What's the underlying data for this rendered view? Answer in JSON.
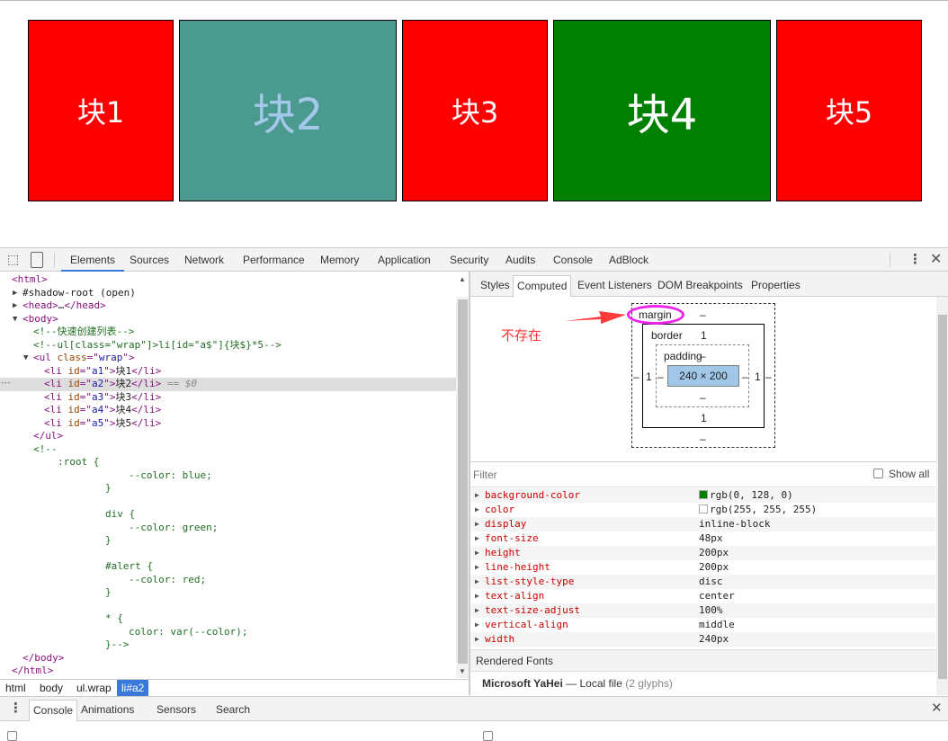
{
  "page": {
    "blocks": [
      {
        "label": "块1",
        "bg": "#ff0000",
        "fg": "#ffffff"
      },
      {
        "label": "块2",
        "bg": "#4a9a8f",
        "fg": "#a3c8ea"
      },
      {
        "label": "块3",
        "bg": "#ff0000",
        "fg": "#ffffff"
      },
      {
        "label": "块4",
        "bg": "#008000",
        "fg": "#ffffff"
      },
      {
        "label": "块5",
        "bg": "#ff0000",
        "fg": "#ffffff"
      }
    ]
  },
  "devtools": {
    "main_tabs": [
      "Elements",
      "Sources",
      "Network",
      "Performance",
      "Memory",
      "Application",
      "Security",
      "Audits",
      "Console",
      "AdBlock"
    ],
    "active_tab": "Elements",
    "dom_lines": [
      [
        {
          "k": "tag",
          "t": "<html>"
        }
      ],
      [
        {
          "k": "plain",
          "t": "#shadow-root (open)"
        }
      ],
      [
        {
          "k": "tag",
          "t": "<head>"
        },
        {
          "k": "plain",
          "t": "…"
        },
        {
          "k": "tag",
          "t": "</head>"
        }
      ],
      [
        {
          "k": "tag",
          "t": "<body>"
        }
      ],
      [
        {
          "k": "cm",
          "t": "<!--快速创建列表-->"
        }
      ],
      [
        {
          "k": "cm",
          "t": "<!--ul[class=\"wrap\"]>li[id=\"a$\"]{块$}*5-->"
        }
      ],
      [
        {
          "k": "tag",
          "t": "<ul "
        },
        {
          "k": "attr",
          "t": "class"
        },
        {
          "k": "tag",
          "t": "=\""
        },
        {
          "k": "val",
          "t": "wrap"
        },
        {
          "k": "tag",
          "t": "\">"
        }
      ],
      [
        {
          "k": "tag",
          "t": "<li "
        },
        {
          "k": "attr",
          "t": "id"
        },
        {
          "k": "tag",
          "t": "=\""
        },
        {
          "k": "val",
          "t": "a1"
        },
        {
          "k": "tag",
          "t": "\">"
        },
        {
          "k": "plain",
          "t": "块1"
        },
        {
          "k": "tag",
          "t": "</li>"
        }
      ],
      [
        {
          "k": "tag",
          "t": "<li "
        },
        {
          "k": "attr",
          "t": "id"
        },
        {
          "k": "tag",
          "t": "=\""
        },
        {
          "k": "val",
          "t": "a2"
        },
        {
          "k": "tag",
          "t": "\">"
        },
        {
          "k": "plain",
          "t": "块2"
        },
        {
          "k": "tag",
          "t": "</li>"
        },
        {
          "k": "dim",
          "t": " == $0"
        }
      ],
      [
        {
          "k": "tag",
          "t": "<li "
        },
        {
          "k": "attr",
          "t": "id"
        },
        {
          "k": "tag",
          "t": "=\""
        },
        {
          "k": "val",
          "t": "a3"
        },
        {
          "k": "tag",
          "t": "\">"
        },
        {
          "k": "plain",
          "t": "块3"
        },
        {
          "k": "tag",
          "t": "</li>"
        }
      ],
      [
        {
          "k": "tag",
          "t": "<li "
        },
        {
          "k": "attr",
          "t": "id"
        },
        {
          "k": "tag",
          "t": "=\""
        },
        {
          "k": "val",
          "t": "a4"
        },
        {
          "k": "tag",
          "t": "\">"
        },
        {
          "k": "plain",
          "t": "块4"
        },
        {
          "k": "tag",
          "t": "</li>"
        }
      ],
      [
        {
          "k": "tag",
          "t": "<li "
        },
        {
          "k": "attr",
          "t": "id"
        },
        {
          "k": "tag",
          "t": "=\""
        },
        {
          "k": "val",
          "t": "a5"
        },
        {
          "k": "tag",
          "t": "\">"
        },
        {
          "k": "plain",
          "t": "块5"
        },
        {
          "k": "tag",
          "t": "</li>"
        }
      ],
      [
        {
          "k": "tag",
          "t": "</ul>"
        }
      ],
      [
        {
          "k": "cm",
          "t": "<!--"
        }
      ],
      [
        {
          "k": "cm",
          "t": ":root {"
        }
      ],
      [
        {
          "k": "cm",
          "t": "--color: blue;"
        }
      ],
      [
        {
          "k": "cm",
          "t": "}"
        }
      ],
      [],
      [
        {
          "k": "cm",
          "t": "div {"
        }
      ],
      [
        {
          "k": "cm",
          "t": "--color: green;"
        }
      ],
      [
        {
          "k": "cm",
          "t": "}"
        }
      ],
      [],
      [
        {
          "k": "cm",
          "t": "#alert {"
        }
      ],
      [
        {
          "k": "cm",
          "t": "--color: red;"
        }
      ],
      [
        {
          "k": "cm",
          "t": "}"
        }
      ],
      [],
      [
        {
          "k": "cm",
          "t": "* {"
        }
      ],
      [
        {
          "k": "cm",
          "t": "color: var(--color);"
        }
      ],
      [
        {
          "k": "cm",
          "t": "}-->"
        }
      ],
      [
        {
          "k": "tag",
          "t": "</body>"
        }
      ],
      [
        {
          "k": "tag",
          "t": "</html>"
        }
      ]
    ],
    "breadcrumbs": [
      "html",
      "body",
      "ul.wrap",
      "li#a2"
    ],
    "side_tabs": [
      "Styles",
      "Computed",
      "Event Listeners",
      "DOM Breakpoints",
      "Properties"
    ],
    "active_side_tab": "Computed",
    "box_model": {
      "margin_label": "margin",
      "border_label": "border",
      "padding_label": "padding",
      "margin": {
        "top": "–",
        "right": "–",
        "bottom": "–",
        "left": "–"
      },
      "border": {
        "top": "1",
        "right": "1",
        "bottom": "1",
        "left": "1"
      },
      "padding": {
        "top": "–",
        "right": "–",
        "bottom": "–",
        "left": "–"
      },
      "content": "240 × 200"
    },
    "annotation": {
      "text": "不存在",
      "color": "#ff3333",
      "circle_color": "#ee22ee"
    },
    "filter_placeholder": "Filter",
    "show_all_label": "Show all",
    "computed": [
      {
        "name": "background-color",
        "value": "rgb(0, 128, 0)",
        "swatch": "#008000"
      },
      {
        "name": "color",
        "value": "rgb(255, 255, 255)",
        "swatch": "#ffffff"
      },
      {
        "name": "display",
        "value": "inline-block"
      },
      {
        "name": "font-size",
        "value": "48px"
      },
      {
        "name": "height",
        "value": "200px"
      },
      {
        "name": "line-height",
        "value": "200px"
      },
      {
        "name": "list-style-type",
        "value": "disc"
      },
      {
        "name": "text-align",
        "value": "center"
      },
      {
        "name": "text-size-adjust",
        "value": "100%"
      },
      {
        "name": "vertical-align",
        "value": "middle"
      },
      {
        "name": "width",
        "value": "240px"
      }
    ],
    "rendered_fonts_title": "Rendered Fonts",
    "font_name": "Microsoft YaHei",
    "font_dash": "—",
    "font_source": "Local file",
    "font_glyphs": "(2 glyphs)",
    "drawer_tabs": [
      "Console",
      "Animations",
      "Sensors",
      "Search"
    ],
    "active_drawer_tab": "Console"
  }
}
